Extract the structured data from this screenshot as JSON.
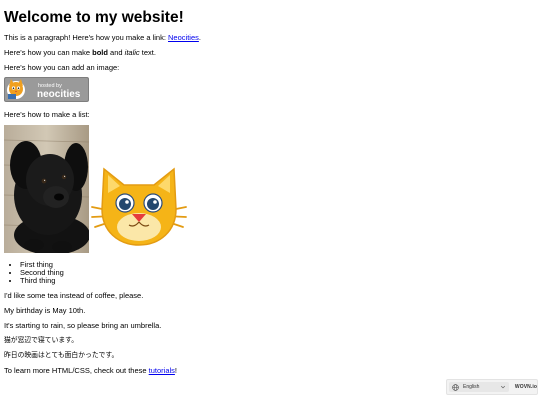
{
  "heading": "Welcome to my website!",
  "p1": {
    "text": "This is a paragraph! Here's how you make a link: ",
    "link": "Neocities",
    "end": "."
  },
  "p2": {
    "before": "Here's how you can make ",
    "bold": "bold",
    "mid": " and ",
    "italic": "italic",
    "after": " text."
  },
  "p3": "Here's how you can add an image:",
  "badge": {
    "small": "hosted by",
    "big": "neocities"
  },
  "p4": "Here's how to make a list:",
  "list": [
    "First thing",
    "Second thing",
    "Third thing"
  ],
  "p5": "I'd like some tea instead of coffee, please.",
  "p6": "My birthday is May 10th.",
  "p7": "It's starting to rain, so please bring an umbrella.",
  "p8": "猫が窓辺で寝ています。",
  "p9": "昨日の映画はとても面白かったです。",
  "p10": {
    "text": "To learn more HTML/CSS, check out these ",
    "link": "tutorials",
    "end": "!"
  },
  "language_widget": {
    "value": "English",
    "brand": "WOVN.io"
  },
  "colors": {
    "link": "#0000ee",
    "badge_bg": "#9a9a9a",
    "cat_fill": "#f5b417"
  }
}
